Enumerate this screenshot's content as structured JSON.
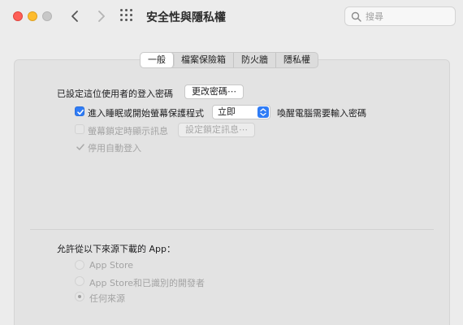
{
  "window": {
    "title": "安全性與隱私權"
  },
  "search": {
    "placeholder": "搜尋",
    "value": ""
  },
  "tabs": [
    {
      "label": "一般",
      "active": true
    },
    {
      "label": "檔案保險箱",
      "active": false
    },
    {
      "label": "防火牆",
      "active": false
    },
    {
      "label": "隱私權",
      "active": false
    }
  ],
  "general": {
    "password_set_label": "已設定這位使用者的登入密碼",
    "change_password_button": "更改密碼⋯",
    "require_password": {
      "label": "進入睡眠或開始螢幕保護程式",
      "checked": true,
      "select_value": "立即",
      "suffix": "喚醒電腦需要輸入密碼"
    },
    "lock_message": {
      "label": "螢幕鎖定時顯示訊息",
      "checked": false,
      "button": "設定鎖定訊息⋯"
    },
    "auto_login": {
      "label": "停用自動登入",
      "checked": true
    }
  },
  "downloads": {
    "heading": "允許從以下來源下載的 App：",
    "options": [
      {
        "label": "App Store",
        "selected": false
      },
      {
        "label": "App Store和已識別的開發者",
        "selected": false
      },
      {
        "label": "任何來源",
        "selected": true
      }
    ]
  },
  "colors": {
    "accent": "#2f7cf6",
    "close": "#fe5f57",
    "minimize": "#febc2e"
  }
}
